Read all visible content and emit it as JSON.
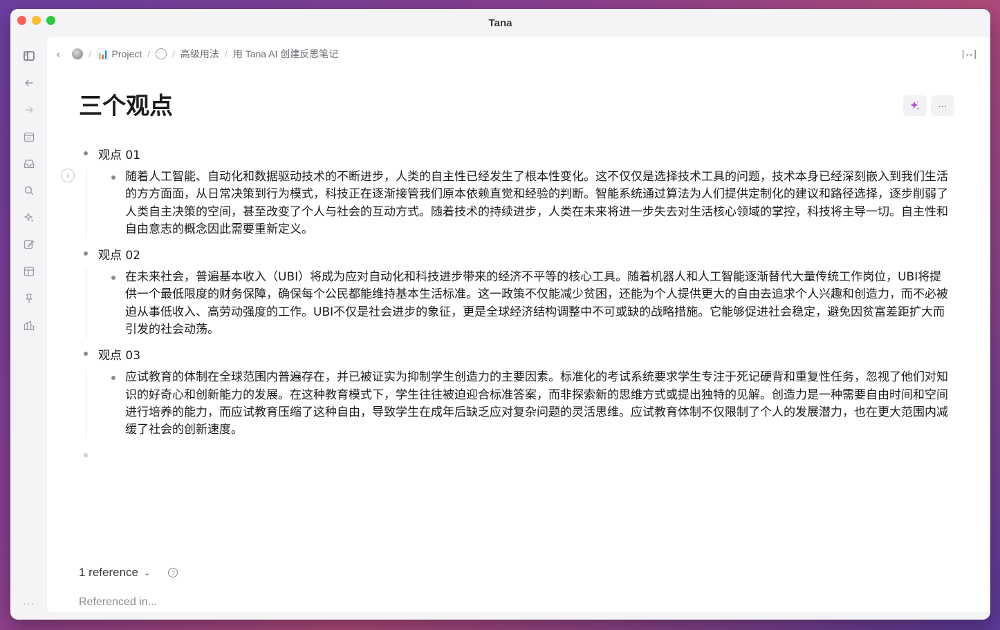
{
  "window": {
    "title": "Tana"
  },
  "breadcrumb": {
    "items": [
      "📊 Project",
      "高级用法",
      "用 Tana AI 创建反思笔记"
    ],
    "dots": "···"
  },
  "page": {
    "title": "三个观点"
  },
  "actions": {
    "ai_icon": "sparkle-icon",
    "more": "···"
  },
  "nodes": [
    {
      "label": "观点 01",
      "child": "随着人工智能、自动化和数据驱动技术的不断进步，人类的自主性已经发生了根本性变化。这不仅仅是选择技术工具的问题，技术本身已经深刻嵌入到我们生活的方方面面，从日常决策到行为模式，科技正在逐渐接管我们原本依赖直觉和经验的判断。智能系统通过算法为人们提供定制化的建议和路径选择，逐步削弱了人类自主决策的空间，甚至改变了个人与社会的互动方式。随着技术的持续进步，人类在未来将进一步失去对生活核心领域的掌控，科技将主导一切。自主性和自由意志的概念因此需要重新定义。"
    },
    {
      "label": "观点 02",
      "child": "在未来社会，普遍基本收入（UBI）将成为应对自动化和科技进步带来的经济不平等的核心工具。随着机器人和人工智能逐渐替代大量传统工作岗位，UBI将提供一个最低限度的财务保障，确保每个公民都能维持基本生活标准。这一政策不仅能减少贫困，还能为个人提供更大的自由去追求个人兴趣和创造力，而不必被迫从事低收入、高劳动强度的工作。UBI不仅是社会进步的象征，更是全球经济结构调整中不可或缺的战略措施。它能够促进社会稳定，避免因贫富差距扩大而引发的社会动荡。"
    },
    {
      "label": "观点 03",
      "child": "应试教育的体制在全球范围内普遍存在，并已被证实为抑制学生创造力的主要因素。标准化的考试系统要求学生专注于死记硬背和重复性任务，忽视了他们对知识的好奇心和创新能力的发展。在这种教育模式下，学生往往被迫迎合标准答案，而非探索新的思维方式或提出独特的见解。创造力是一种需要自由时间和空间进行培养的能力，而应试教育压缩了这种自由，导致学生在成年后缺乏应对复杂问题的灵活思维。应试教育体制不仅限制了个人的发展潜力，也在更大范围内减缓了社会的创新速度。"
    }
  ],
  "reference": {
    "label": "1 reference",
    "referenced_in": "Referenced in..."
  },
  "sidebar_more": "···"
}
